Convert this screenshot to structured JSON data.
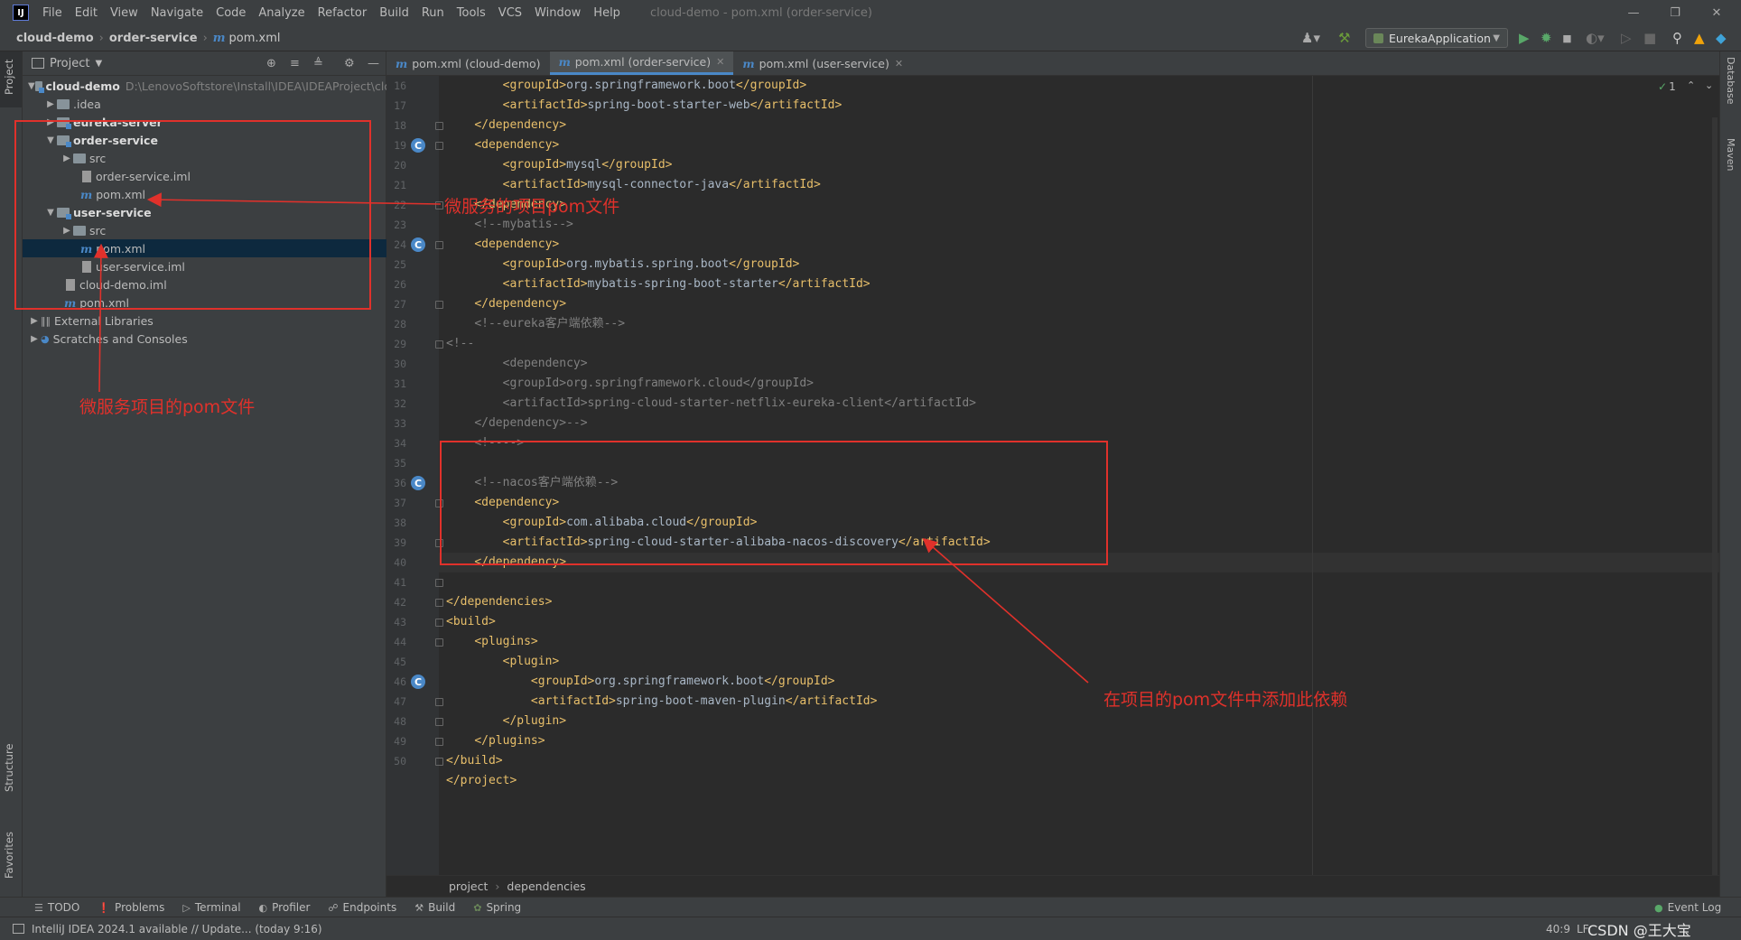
{
  "menu": {
    "items": [
      "File",
      "Edit",
      "View",
      "Navigate",
      "Code",
      "Analyze",
      "Refactor",
      "Build",
      "Run",
      "Tools",
      "VCS",
      "Window",
      "Help"
    ],
    "window_title": "cloud-demo - pom.xml (order-service)"
  },
  "nav": {
    "crumb_project": "cloud-demo",
    "crumb_module": "order-service",
    "crumb_file": "pom.xml",
    "run_config": "EurekaApplication"
  },
  "left_strip": {
    "project": "Project",
    "structure": "Structure",
    "favorites": "Favorites"
  },
  "right_strip": {
    "database": "Database",
    "maven": "Maven"
  },
  "project_panel": {
    "title": "Project",
    "tree": [
      {
        "name": "cloud-demo",
        "path": "D:\\LenovoSoftstore\\Install\\IDEA\\IDEAProject\\clo"
      },
      {
        "name": ".idea"
      },
      {
        "name": "eureka-server"
      },
      {
        "name": "order-service"
      },
      {
        "name": "src"
      },
      {
        "name": "order-service.iml"
      },
      {
        "name": "pom.xml"
      },
      {
        "name": "user-service"
      },
      {
        "name": "src"
      },
      {
        "name": "pom.xml"
      },
      {
        "name": "user-service.iml"
      },
      {
        "name": "cloud-demo.iml"
      },
      {
        "name": "pom.xml"
      },
      {
        "name": "External Libraries"
      },
      {
        "name": "Scratches and Consoles"
      }
    ]
  },
  "tabs": [
    {
      "label": "pom.xml (cloud-demo)"
    },
    {
      "label": "pom.xml (order-service)"
    },
    {
      "label": "pom.xml (user-service)"
    }
  ],
  "editor": {
    "inspection_count": "1",
    "line_numbers": [
      "16",
      "17",
      "18",
      "19",
      "20",
      "21",
      "22",
      "23",
      "24",
      "25",
      "26",
      "27",
      "28",
      "29",
      "30",
      "31",
      "32",
      "33",
      "34",
      "35",
      "36",
      "37",
      "38",
      "39",
      "40",
      "41",
      "42",
      "43",
      "44",
      "45",
      "46",
      "47",
      "48",
      "49",
      "50"
    ],
    "lines": [
      [
        "        ",
        "<groupId>",
        "org.springframework.boot",
        "</groupId>"
      ],
      [
        "        ",
        "<artifactId>",
        "spring-boot-starter-web",
        "</artifactId>"
      ],
      [
        "    ",
        "</dependency>",
        "",
        ""
      ],
      [
        "    ",
        "<dependency>",
        "",
        ""
      ],
      [
        "        ",
        "<groupId>",
        "mysql",
        "</groupId>"
      ],
      [
        "        ",
        "<artifactId>",
        "mysql-connector-java",
        "</artifactId>"
      ],
      [
        "    ",
        "</dependency>",
        "",
        ""
      ],
      [
        "    ",
        "<!--mybatis-->",
        "",
        ""
      ],
      [
        "    ",
        "<dependency>",
        "",
        ""
      ],
      [
        "        ",
        "<groupId>",
        "org.mybatis.spring.boot",
        "</groupId>"
      ],
      [
        "        ",
        "<artifactId>",
        "mybatis-spring-boot-starter",
        "</artifactId>"
      ],
      [
        "    ",
        "</dependency>",
        "",
        ""
      ],
      [
        "    ",
        "<!--eureka客户端依赖-->",
        "",
        ""
      ],
      [
        "",
        "<!--",
        "",
        ""
      ],
      [
        "        ",
        "<dependency>",
        "",
        ""
      ],
      [
        "        ",
        "<groupId>org.springframework.cloud</groupId>",
        "",
        ""
      ],
      [
        "        ",
        "<artifactId>spring-cloud-starter-netflix-eureka-client</artifactId>",
        "",
        ""
      ],
      [
        "    ",
        "</dependency>-->",
        "",
        ""
      ],
      [
        "    ",
        "<!---->",
        "",
        ""
      ],
      [
        "",
        "",
        "",
        ""
      ],
      [
        "    ",
        "<!--nacos客户端依赖-->",
        "",
        ""
      ],
      [
        "    ",
        "<dependency>",
        "",
        ""
      ],
      [
        "        ",
        "<groupId>",
        "com.alibaba.cloud",
        "</groupId>"
      ],
      [
        "        ",
        "<artifactId>",
        "spring-cloud-starter-alibaba-nacos-discovery",
        "</artifactId>"
      ],
      [
        "    ",
        "</dependency>",
        "",
        ""
      ],
      [
        "",
        "",
        "",
        ""
      ],
      [
        "",
        "</dependencies>",
        "",
        ""
      ],
      [
        "",
        "<build>",
        "",
        ""
      ],
      [
        "    ",
        "<plugins>",
        "",
        ""
      ],
      [
        "        ",
        "<plugin>",
        "",
        ""
      ],
      [
        "            ",
        "<groupId>",
        "org.springframework.boot",
        "</groupId>"
      ],
      [
        "            ",
        "<artifactId>",
        "spring-boot-maven-plugin",
        "</artifactId>"
      ],
      [
        "        ",
        "</plugin>",
        "",
        ""
      ],
      [
        "    ",
        "</plugins>",
        "",
        ""
      ],
      [
        "",
        "</build>",
        "",
        ""
      ],
      [
        "",
        "</project>",
        "",
        ""
      ]
    ],
    "breadcrumb": [
      "project",
      "dependencies"
    ]
  },
  "tool_windows": [
    "TODO",
    "Problems",
    "Terminal",
    "Profiler",
    "Endpoints",
    "Build",
    "Spring"
  ],
  "event_log": "Event Log",
  "status": {
    "message": "IntelliJ IDEA 2024.1 available // Update... (today 9:16)",
    "position": "40:9",
    "line_sep": "LF",
    "watermark": "CSDN @王大宝"
  },
  "annotations": {
    "label_1": "微服务的项目pom文件",
    "label_2": "微服务项目的pom文件",
    "label_3": "在项目的pom文件中添加此依赖",
    "color": "#e0312b"
  }
}
